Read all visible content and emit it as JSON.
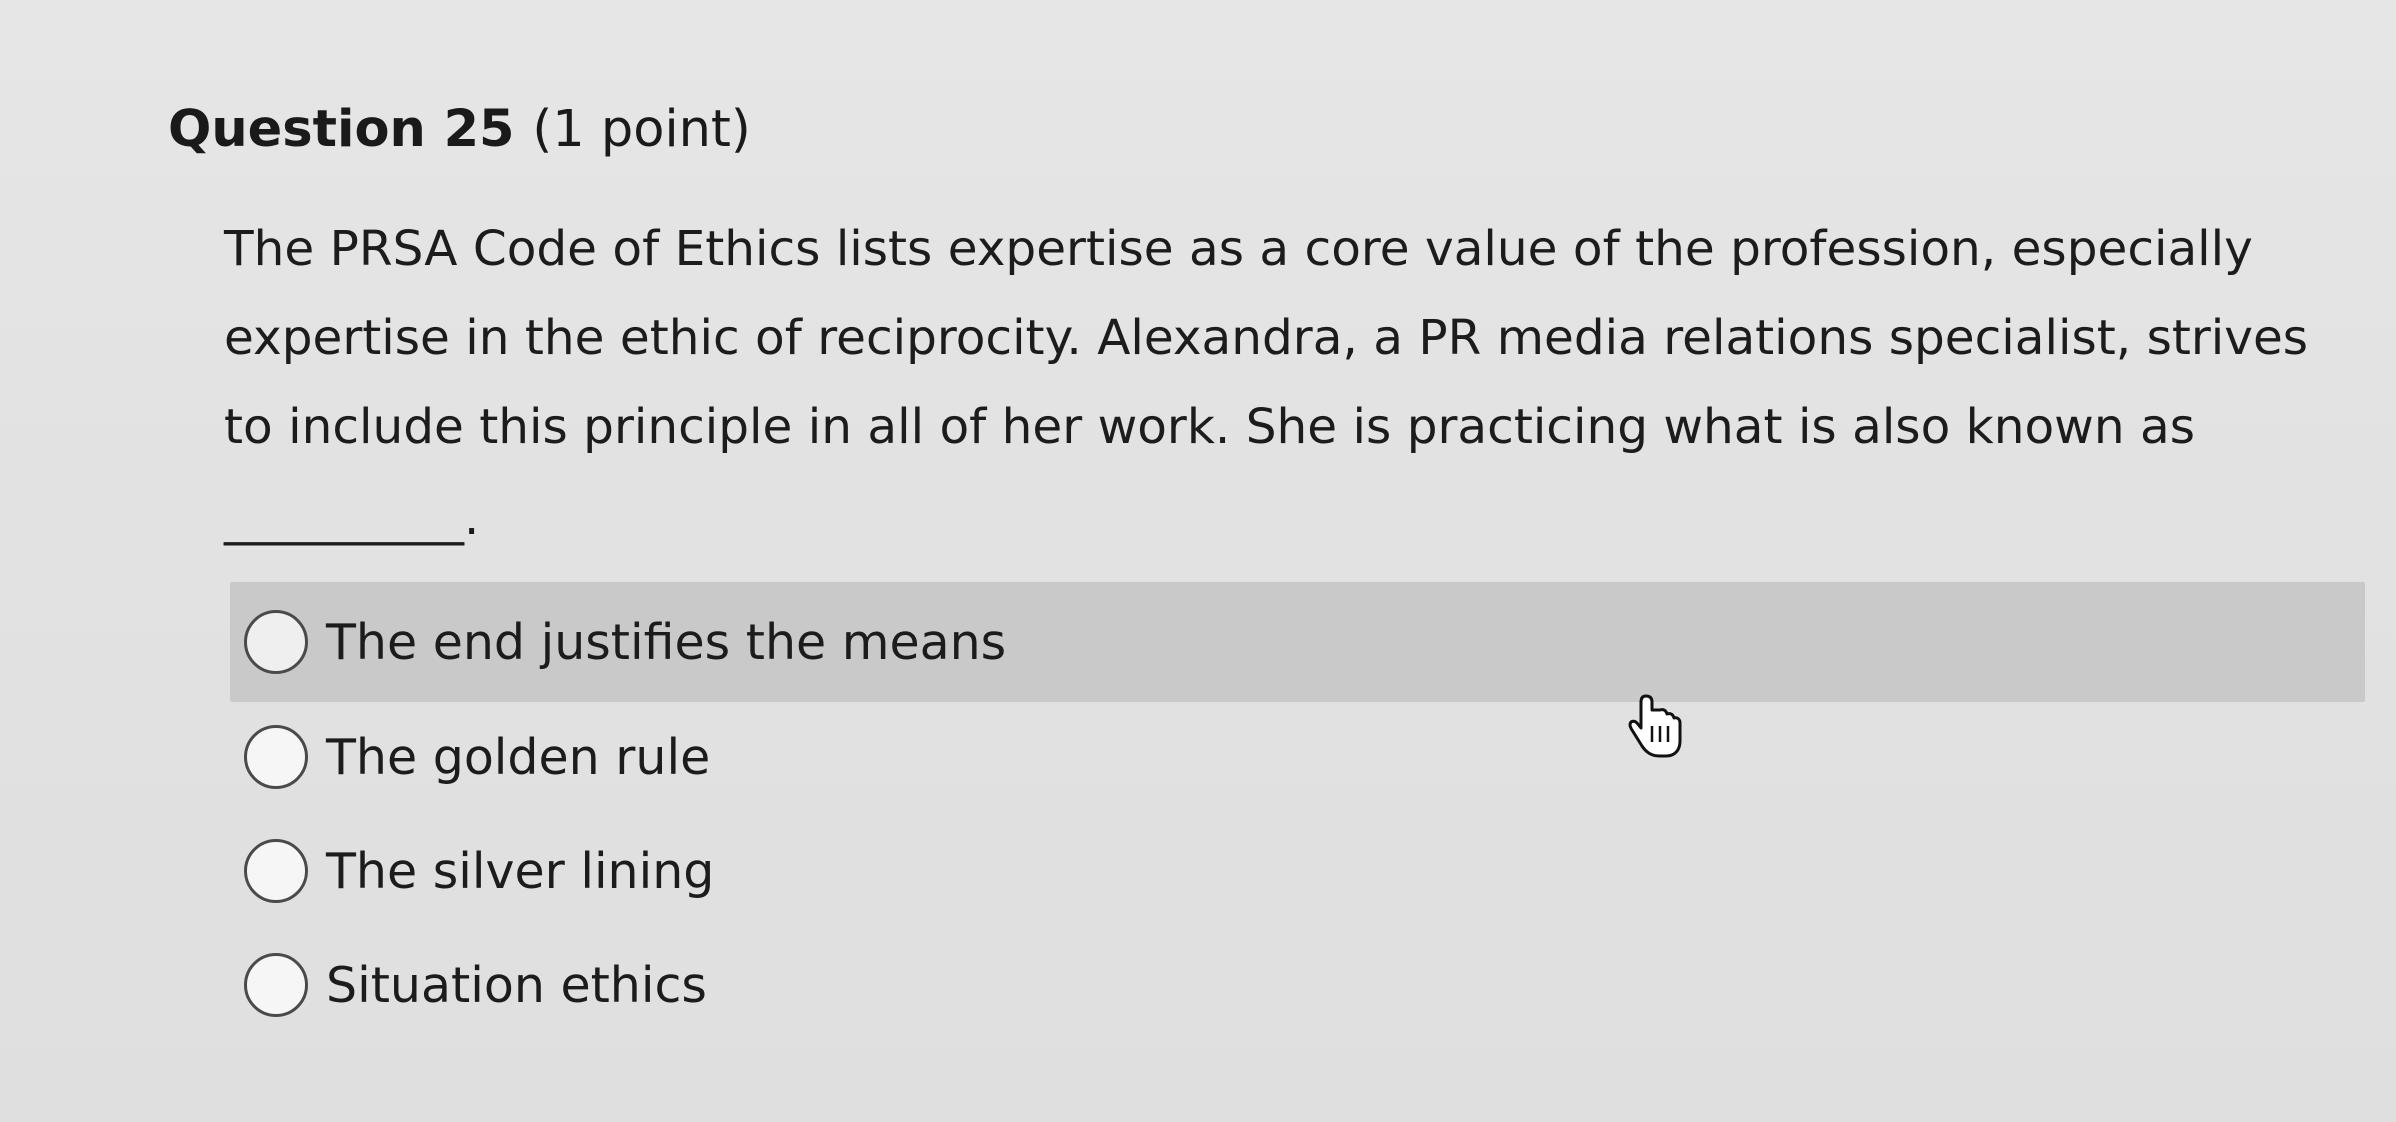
{
  "question": {
    "heading": "Question 25",
    "points": "(1 point)",
    "text": "The PRSA Code of Ethics lists expertise as a core value of the profession, especially expertise in the ethic of reciprocity. Alexandra, a PR media relations specialist, strives to include this principle in all of her work. She is practicing what is also known as",
    "blank": "__________."
  },
  "options": [
    {
      "label": "The end justifies the means",
      "selected": false,
      "hovered": true
    },
    {
      "label": "The golden rule",
      "selected": false,
      "hovered": false
    },
    {
      "label": "The silver lining",
      "selected": false,
      "hovered": false
    },
    {
      "label": "Situation ethics",
      "selected": false,
      "hovered": false
    }
  ],
  "cursor": {
    "icon": "hand-pointer-icon"
  }
}
